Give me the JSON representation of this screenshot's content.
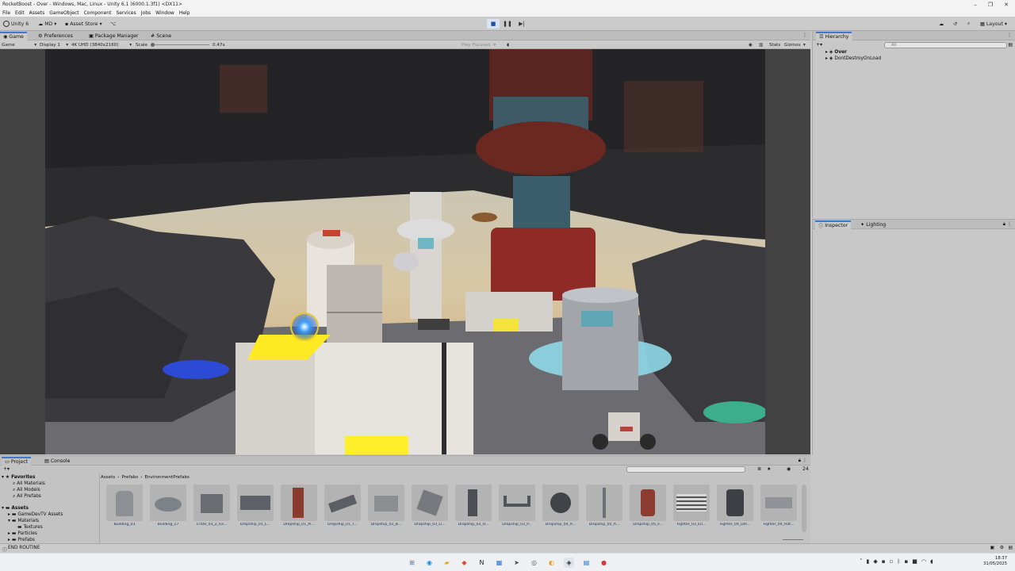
{
  "window": {
    "title": "RocketBoost - Over - Windows, Mac, Linux - Unity 6.1 (6000.1.3f1) <DX11>"
  },
  "menu": [
    "File",
    "Edit",
    "Assets",
    "GameObject",
    "Component",
    "Services",
    "Jobs",
    "Window",
    "Help"
  ],
  "toolbar": {
    "unity_label": "Unity 6",
    "account_label": "MD",
    "asset_store_label": "Asset Store",
    "layout_label": "Layout"
  },
  "tabs": {
    "game": "Game",
    "preferences": "Preferences",
    "package_manager": "Package Manager",
    "scene": "Scene"
  },
  "gamebar": {
    "mode": "Game",
    "display": "Display 1",
    "resolution": "4K UHD (3840x2160)",
    "scale_label": "Scale",
    "scale_value": "0.47x",
    "play_focused": "Play Focused",
    "stats": "Stats",
    "gizmos": "Gizmos"
  },
  "hierarchy": {
    "tab_label": "Hierarchy",
    "search_placeholder": "All",
    "items": [
      "Over",
      "DontDestroyOnLoad"
    ]
  },
  "inspector": {
    "tab_label": "Inspector",
    "lighting_label": "Lighting"
  },
  "project": {
    "tab_project": "Project",
    "tab_console": "Console",
    "breadcrumb": [
      "Assets",
      "Prefabs",
      "EnvironmentPrefabs"
    ],
    "count": "24",
    "tree": {
      "favorites": "Favorites",
      "fav_items": [
        "All Materials",
        "All Models",
        "All Prefabs"
      ],
      "assets": "Assets",
      "asset_items": [
        "GameDevTV Assets",
        "Materials",
        "Textures",
        "Particles",
        "Prefabs"
      ]
    },
    "assets": [
      "Building_03",
      "Building_17",
      "Crate_03_2_03...",
      "Dropship_01_L...",
      "Dropship_01_Pi...",
      "Dropship_01_T...",
      "Dropship_02_B...",
      "Dropship_03_Li...",
      "Dropship_03_H...",
      "Dropship_03_P...",
      "Dropship_04_A...",
      "Dropship_05_A...",
      "Dropship_05_F...",
      "Fighter_03_En...",
      "Fighter_04_Del...",
      "Fighter_04_Hat..."
    ]
  },
  "status": {
    "message": "END ROUTINE"
  },
  "clock": {
    "time": "18:37",
    "date": "31/05/2025"
  }
}
